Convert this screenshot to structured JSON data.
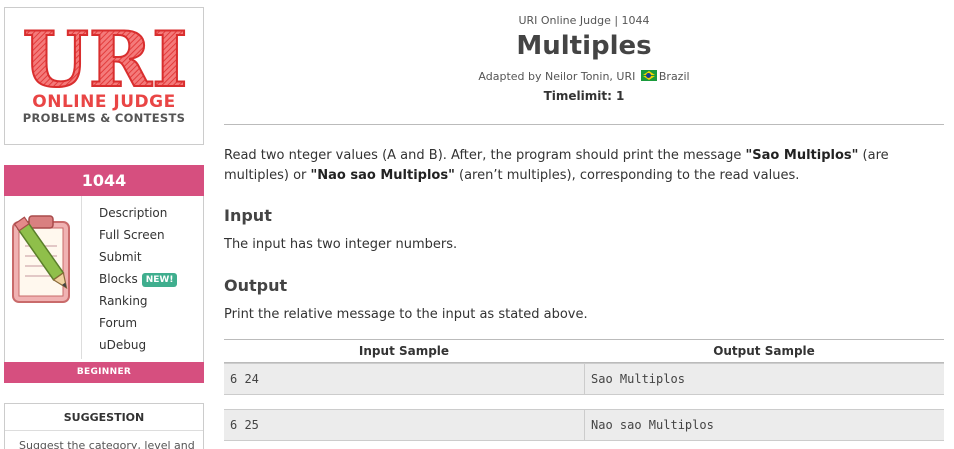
{
  "sidebar": {
    "logo": {
      "main": "URI",
      "line1": "ONLINE JUDGE",
      "line2": "PROBLEMS & CONTESTS"
    },
    "problem": {
      "id": "1044",
      "menu": [
        {
          "label": "Description"
        },
        {
          "label": "Full Screen"
        },
        {
          "label": "Submit"
        },
        {
          "label": "Blocks",
          "badge": "NEW!"
        },
        {
          "label": "Ranking"
        },
        {
          "label": "Forum"
        },
        {
          "label": "uDebug"
        }
      ],
      "level": "BEGINNER"
    },
    "suggestion": {
      "title": "SUGGESTION",
      "text": "Suggest the category, level and"
    }
  },
  "header": {
    "judge_ref": "URI Online Judge | 1044",
    "title": "Multiples",
    "adapted_prefix": "Adapted by Neilor Tonin, URI",
    "country": "Brazil",
    "timelimit": "Timelimit: 1"
  },
  "content": {
    "desc_1": "Read two nteger values (A and B). After, the program should print the message ",
    "desc_b1": "\"Sao Multiplos\"",
    "desc_2": " (are multiples) or ",
    "desc_b2": "\"Nao sao Multiplos\"",
    "desc_3": " (aren’t multiples), corresponding to the read values.",
    "input_heading": "Input",
    "input_text": "The input has two integer numbers.",
    "output_heading": "Output",
    "output_text": "Print the relative message to the input as stated above."
  },
  "samples": {
    "input_header": "Input Sample",
    "output_header": "Output Sample",
    "rows": [
      {
        "input": "6 24",
        "output": "Sao Multiplos"
      },
      {
        "input": "6 25",
        "output": "Nao sao Multiplos"
      }
    ]
  },
  "colors": {
    "accent": "#d64f7f",
    "logo_red": "#e94545",
    "new_badge": "#3fae8e"
  }
}
